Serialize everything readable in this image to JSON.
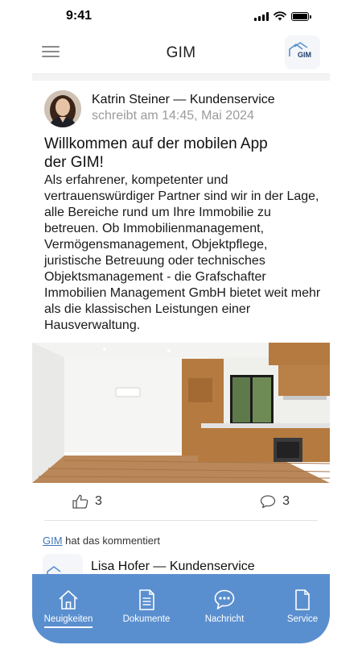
{
  "status_bar": {
    "time": "9:41"
  },
  "header": {
    "title": "GIM",
    "logo_text": "GIM"
  },
  "post": {
    "author": "Katrin Steiner — Kundenservice",
    "meta": "schreibt am 14:45, Mai 2024",
    "title": "Willkommen auf der mobilen App der GIM!",
    "body": "Als erfahrener, kompetenter und vertrauenswürdiger Partner sind wir in der Lage, alle Bereiche rund um Ihre Immobilie zu betreuen. Ob Immobilienmanagement, Vermögensmanagement, Objektpflege, juristische Betreuung oder technisches Objektsmanagement - die Grafschafter Immobilien Management GmbH bietet weit mehr als die klassischen Leistungen einer Hausverwaltung.",
    "likes": "3",
    "comments": "3"
  },
  "comment": {
    "link": "GIM",
    "note": " hat das kommentiert",
    "author": "Lisa Hofer — Kundenservice"
  },
  "nav": {
    "items": [
      {
        "label": "Neuigkeiten",
        "icon": "house-icon",
        "active": true
      },
      {
        "label": "Dokumente",
        "icon": "document-icon",
        "active": false
      },
      {
        "label": "Nachricht",
        "icon": "chat-icon",
        "active": false
      },
      {
        "label": "Service",
        "icon": "file-icon",
        "active": false
      }
    ]
  },
  "colors": {
    "accent": "#5a8fcf",
    "link": "#3f76b8"
  }
}
